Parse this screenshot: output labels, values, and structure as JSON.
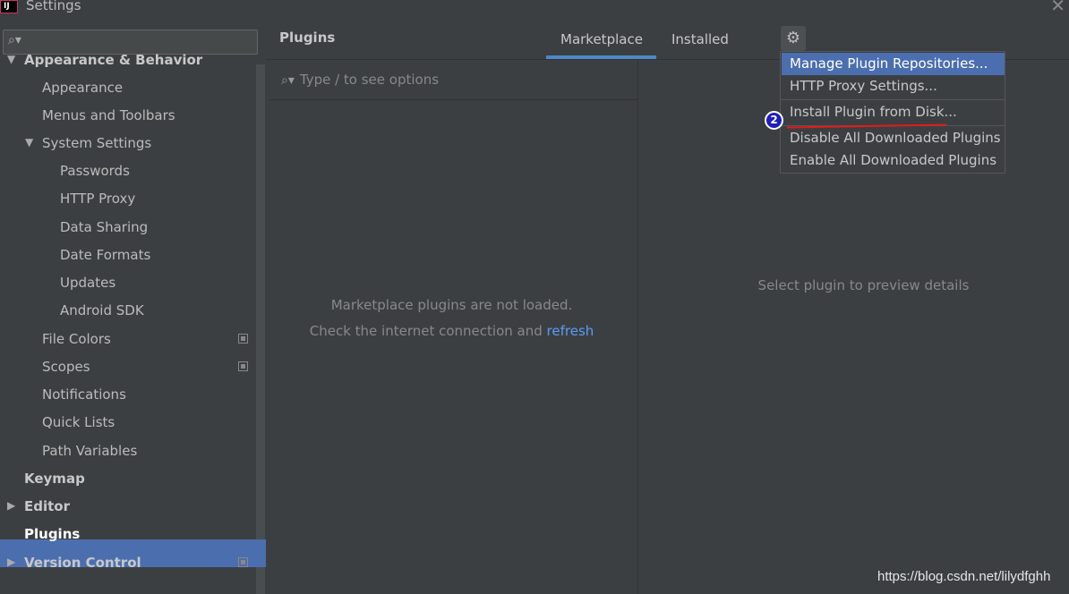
{
  "window": {
    "title": "Settings",
    "close_glyph": "✕",
    "app_icon_text": "IJ"
  },
  "sidebar": {
    "search_placeholder": "",
    "items": [
      {
        "label": "Appearance & Behavior",
        "level": 0,
        "bold": true,
        "arrow": "expanded"
      },
      {
        "label": "Appearance",
        "level": 1
      },
      {
        "label": "Menus and Toolbars",
        "level": 1
      },
      {
        "label": "System Settings",
        "level": 1,
        "arrow": "expanded"
      },
      {
        "label": "Passwords",
        "level": 2
      },
      {
        "label": "HTTP Proxy",
        "level": 2
      },
      {
        "label": "Data Sharing",
        "level": 2
      },
      {
        "label": "Date Formats",
        "level": 2
      },
      {
        "label": "Updates",
        "level": 2
      },
      {
        "label": "Android SDK",
        "level": 2
      },
      {
        "label": "File Colors",
        "level": 1,
        "copy_icon": true
      },
      {
        "label": "Scopes",
        "level": 1,
        "copy_icon": true
      },
      {
        "label": "Notifications",
        "level": 1
      },
      {
        "label": "Quick Lists",
        "level": 1
      },
      {
        "label": "Path Variables",
        "level": 1
      },
      {
        "label": "Keymap",
        "level": 0,
        "bold": true
      },
      {
        "label": "Editor",
        "level": 0,
        "bold": true,
        "arrow": "collapsed"
      },
      {
        "label": "Plugins",
        "level": 0,
        "bold": true,
        "selected": true
      },
      {
        "label": "Version Control",
        "level": 0,
        "bold": true,
        "arrow": "collapsed",
        "copy_icon": true
      }
    ]
  },
  "main": {
    "title": "Plugins",
    "tabs": [
      {
        "label": "Marketplace",
        "active": true
      },
      {
        "label": "Installed",
        "active": false
      }
    ],
    "options_search_placeholder": "Type / to see options",
    "empty_message_line1": "Marketplace plugins are not loaded.",
    "empty_message_line2": "Check the internet connection and",
    "refresh_link": "refresh",
    "preview_message": "Select plugin to preview details"
  },
  "gear_menu": {
    "items": [
      {
        "label": "Manage Plugin Repositories...",
        "highlighted": true
      },
      {
        "label": "HTTP Proxy Settings..."
      },
      {
        "label": "Install Plugin from Disk..."
      },
      {
        "label": "Disable All Downloaded Plugins"
      },
      {
        "label": "Enable All Downloaded Plugins"
      }
    ]
  },
  "annotation": {
    "badge_number": "2",
    "color": "#e01c1c"
  },
  "watermark": "https://blog.csdn.net/lilydfghh",
  "colors": {
    "accent": "#4b6eaf",
    "link": "#589df6",
    "background": "#3c3f41"
  }
}
